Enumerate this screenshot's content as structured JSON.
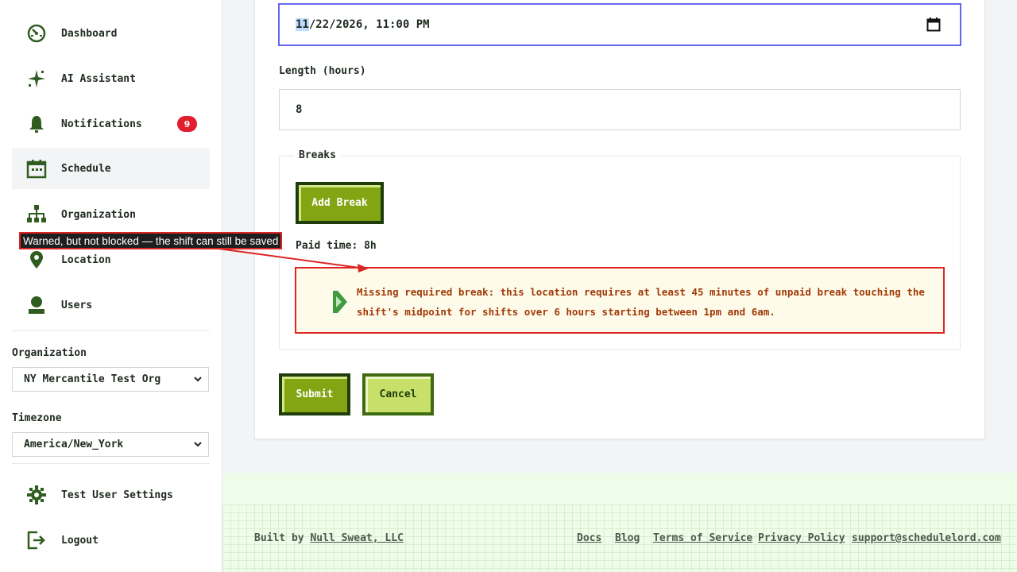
{
  "sidebar": {
    "items": [
      {
        "label": "Dashboard",
        "icon": "dashboard-icon"
      },
      {
        "label": "AI Assistant",
        "icon": "sparkle-icon"
      },
      {
        "label": "Notifications",
        "icon": "bell-icon",
        "badge": "9"
      },
      {
        "label": "Schedule",
        "icon": "calendar-icon",
        "active": true
      },
      {
        "label": "Organization",
        "icon": "org-chart-icon"
      },
      {
        "label": "Location",
        "icon": "location-pin-icon"
      },
      {
        "label": "Users",
        "icon": "user-icon"
      },
      {
        "label": "Test User Settings",
        "icon": "gear-icon"
      },
      {
        "label": "Logout",
        "icon": "logout-icon"
      }
    ],
    "organization": {
      "label": "Organization",
      "value": "NY Mercantile Test Org"
    },
    "timezone": {
      "label": "Timezone",
      "value": "America/New_York"
    }
  },
  "form": {
    "start_datetime": {
      "highlight": "11",
      "rest": "/22/2026, 11:00 PM"
    },
    "length": {
      "label": "Length (hours)",
      "value": "8"
    },
    "breaks": {
      "legend": "Breaks",
      "add_button": "Add Break",
      "paid_time": "Paid time: 8h",
      "warning": "Missing required break: this location requires at least 45 minutes of unpaid break touching the shift's midpoint for shifts over 6 hours starting between 1pm and 6am."
    },
    "submit": "Submit",
    "cancel": "Cancel"
  },
  "footer": {
    "built_prefix": "Built by ",
    "built_link": "Null Sweat, LLC",
    "links": [
      "Docs",
      "Blog",
      "Terms of Service",
      "Privacy Policy",
      "support@schedulelord.com"
    ]
  },
  "annotation": {
    "text": "Warned, but not blocked — the shift can still be saved"
  },
  "colors": {
    "brand_green": "#2f5d1f",
    "button_green": "#84a513",
    "warning_border": "#dc2626",
    "focus_border": "#6366f1",
    "badge_red": "#e11d2e"
  }
}
